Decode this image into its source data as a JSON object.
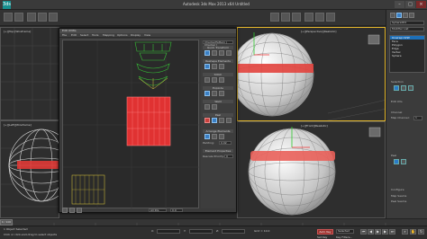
{
  "app": {
    "title": "Autodesk 3ds Max 2013 x64 Untitled",
    "logo": "3ds"
  },
  "viewports": {
    "top_left_label": "[+][Top][Wireframe]",
    "bottom_left_label": "[+][Left][Wireframe]",
    "top_right_label": "[+][Perspective][Realistic]",
    "bottom_right_label": "[+][Front][Realistic]"
  },
  "uv_editor": {
    "title": "Edit UVWs",
    "menu": [
      "File",
      "Edit",
      "Select",
      "Tools",
      "Mapping",
      "Options",
      "Display",
      "View"
    ],
    "map_selector": "CheckerPattern ( Checker )",
    "sections": [
      "Quick Transform",
      "Reshape Elements",
      "Stitch",
      "Explode",
      "Weld",
      "Peel",
      "Arrange Elements",
      "Element Properties"
    ],
    "padding_label": "Padding:",
    "padding_value": "0.02",
    "rescale_label": "Rescale Priority:",
    "rescale_value": "0",
    "bottom_field": "All IDs",
    "bottom_value": "0.0"
  },
  "command_panel": {
    "object_name": "Sphere001",
    "modifier_list_label": "Modifier List",
    "stack": [
      "Unwrap UVW",
      "Face",
      "Polygon",
      "Edge",
      "Vertex",
      "Sphere"
    ],
    "selected_index": 0,
    "rows": [
      "Selection",
      "Edit UVs",
      "Channel",
      "Map Channel:",
      "Peel",
      "Configure",
      "Map Seams",
      "Peel Seams"
    ],
    "map_channel_value": "1"
  },
  "timeline": {
    "frame": "0 / 100"
  },
  "status": {
    "selection": "1 Object Selected",
    "prompt": "Click or click-and-drag to select objects",
    "x_label": "X:",
    "y_label": "Y:",
    "z_label": "Z:",
    "grid": "Grid = 10.0",
    "autokey": "Auto Key",
    "selected": "Selected",
    "set_key": "Set Key",
    "key_filters": "Key Filters..."
  }
}
